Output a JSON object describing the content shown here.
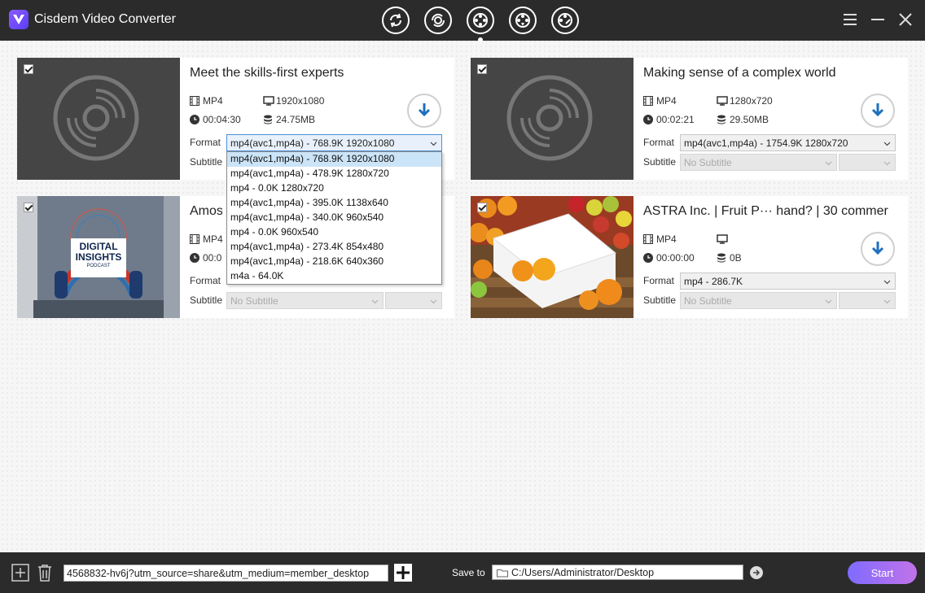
{
  "app": {
    "title": "Cisdem Video Converter"
  },
  "modes": [
    {
      "icon": "convert-icon"
    },
    {
      "icon": "rip-icon"
    },
    {
      "icon": "download-icon",
      "active": true
    },
    {
      "icon": "compress-icon"
    },
    {
      "icon": "edit-icon"
    }
  ],
  "window_controls": [
    "menu-icon",
    "minimize-icon",
    "close-icon"
  ],
  "labels": {
    "format": "Format",
    "subtitle": "Subtitle",
    "no_subtitle": "No Subtitle"
  },
  "cards": [
    {
      "title": "Meet the skills-first experts",
      "container": "MP4",
      "resolution": "1920x1080",
      "duration": "00:04:30",
      "size": "24.75MB",
      "format": "mp4(avc1,mp4a) - 768.9K 1920x1080",
      "subtitle": "No Subtitle",
      "checked": true
    },
    {
      "title": "Making sense of a complex world",
      "container": "MP4",
      "resolution": "1280x720",
      "duration": "00:02:21",
      "size": "29.50MB",
      "format": "mp4(avc1,mp4a) - 1754.9K 1280x720",
      "subtitle": "No Subtitle",
      "checked": true
    },
    {
      "title": "Amos",
      "container": "MP4",
      "resolution": "",
      "duration": "00:0",
      "size": "",
      "format": "",
      "subtitle": "No Subtitle",
      "checked": true,
      "thumb_text": {
        "line1": "DIGITAL",
        "line2": "INSIGHTS",
        "line3": "PODCAST"
      }
    },
    {
      "title": "ASTRA Inc. | Fruit P··· hand? | 30 commer",
      "container": "MP4",
      "resolution": "",
      "duration": "00:00:00",
      "size": "0B",
      "format": "mp4 - 286.7K",
      "subtitle": "No Subtitle",
      "checked": true
    }
  ],
  "format_dropdown": {
    "options": [
      "mp4(avc1,mp4a) - 768.9K 1920x1080",
      "mp4(avc1,mp4a) - 478.9K 1280x720",
      "mp4 - 0.0K 1280x720",
      "mp4(avc1,mp4a) - 395.0K 1138x640",
      "mp4(avc1,mp4a) - 340.0K 960x540",
      "mp4 - 0.0K 960x540",
      "mp4(avc1,mp4a) - 273.4K 854x480",
      "mp4(avc1,mp4a) - 218.6K 640x360",
      "m4a - 64.0K"
    ],
    "selected_index": 0
  },
  "bottom": {
    "url_value": "4568832-hv6j?utm_source=share&utm_medium=member_desktop",
    "save_to_label": "Save to",
    "save_path": "C:/Users/Administrator/Desktop",
    "start_label": "Start"
  },
  "colors": {
    "accent": "#1f6fbf",
    "titlebar": "#2b2b2b",
    "start_from": "#7f6bff",
    "start_to": "#c173e8"
  }
}
